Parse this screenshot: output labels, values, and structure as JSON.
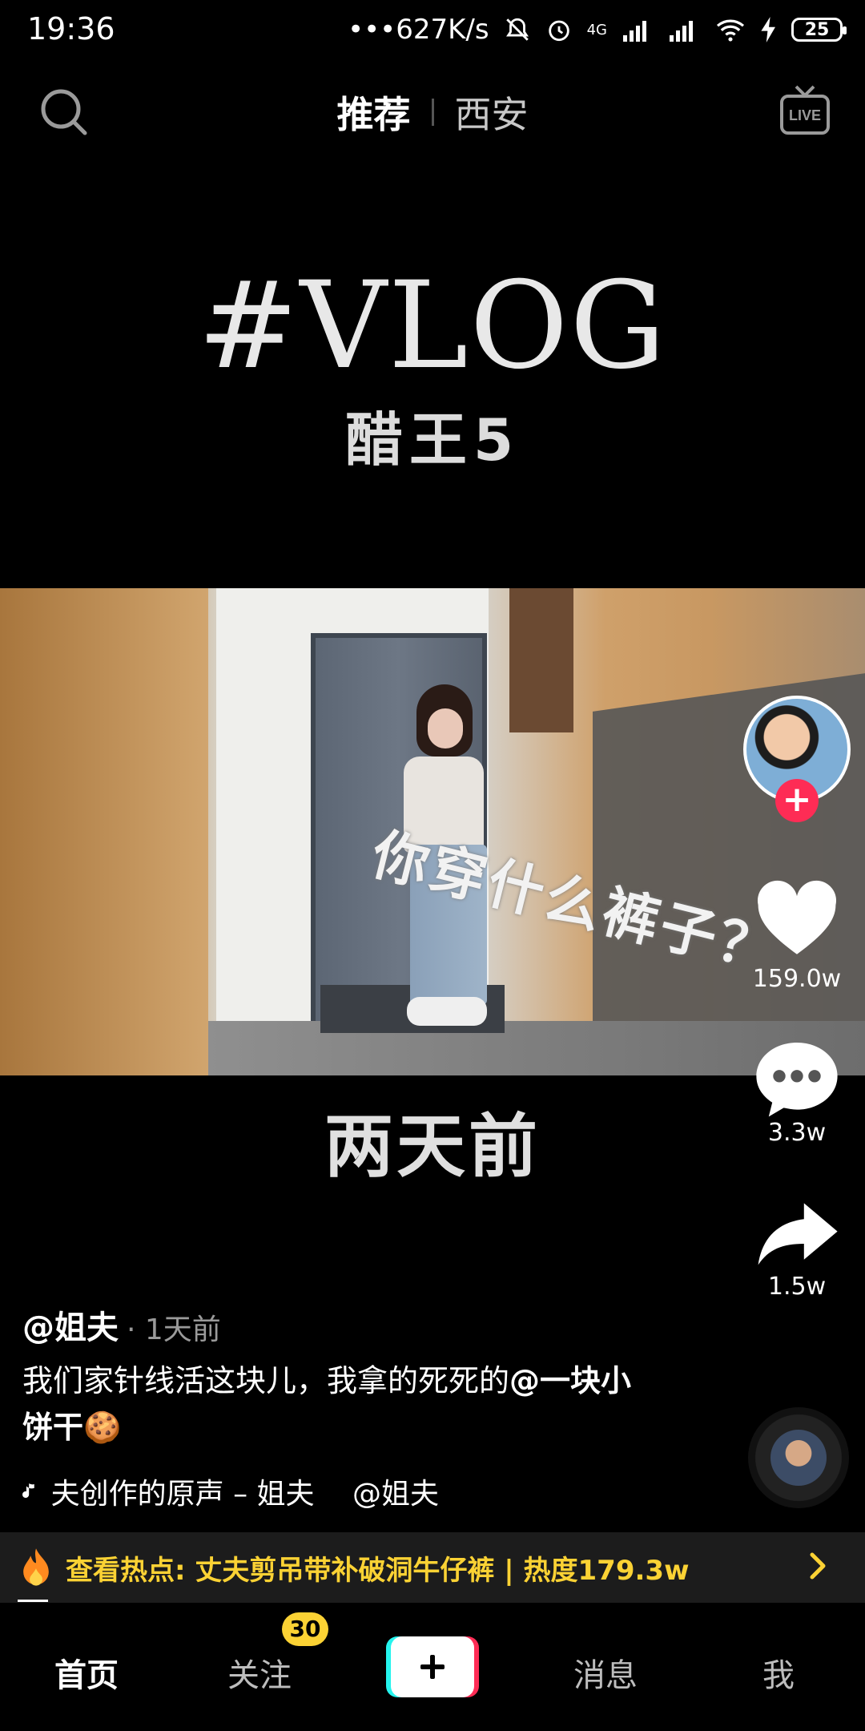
{
  "status_bar": {
    "time": "19:36",
    "net_speed": "•••627K/s",
    "network": "4G",
    "battery": "25"
  },
  "top_nav": {
    "tabs": [
      {
        "label": "推荐",
        "active": true
      },
      {
        "label": "西安",
        "active": false
      }
    ],
    "live_label": "LIVE"
  },
  "video": {
    "overlay_title": "#VLOG",
    "overlay_subtitle": "醋王5",
    "caption": "你穿什么裤子？",
    "bottom_subtitle": "两天前"
  },
  "actions": {
    "likes": "159.0w",
    "comments": "3.3w",
    "shares": "1.5w"
  },
  "post": {
    "author": "@姐夫",
    "time_ago": "· 1天前",
    "description_text": "我们家针线活这块儿，我拿的死死的",
    "description_mention": "@一块小饼干",
    "emoji": "🍪",
    "music_text": "夫创作的原声 – 姐夫　 @姐夫"
  },
  "hot_bar": {
    "text": "查看热点: 丈夫剪吊带补破洞牛仔裤 | 热度179.3w"
  },
  "tab_bar": {
    "home": "首页",
    "follow": "关注",
    "follow_badge": "30",
    "messages": "消息",
    "me": "我"
  },
  "colors": {
    "accent_red": "#fe2c55",
    "accent_cyan": "#25f4ee",
    "hot_yellow": "#fbd234"
  }
}
